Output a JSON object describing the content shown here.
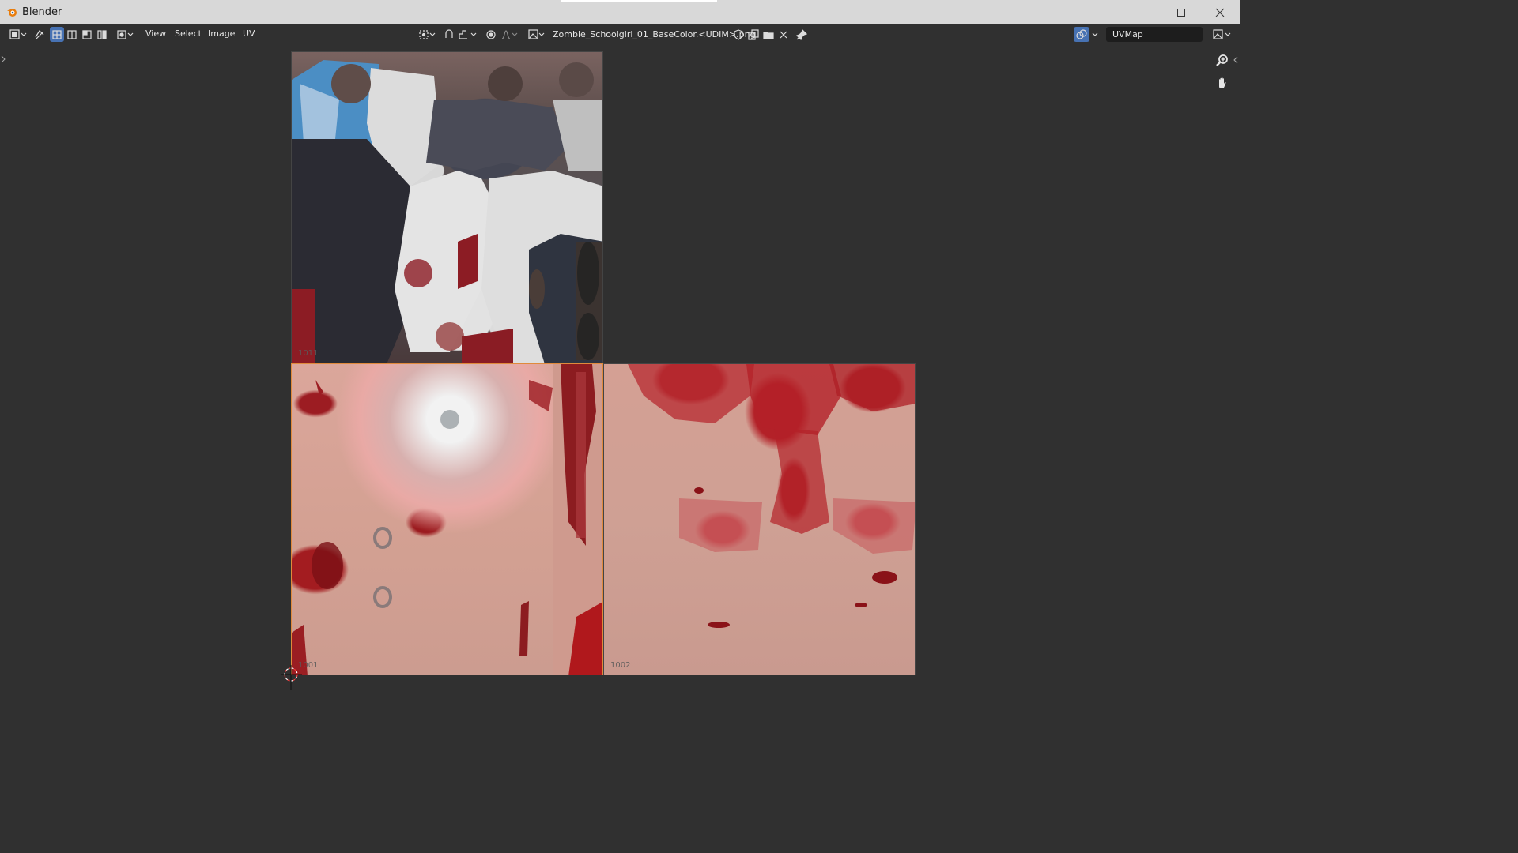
{
  "window": {
    "title": "Blender",
    "controls": [
      "minimize-icon",
      "maximize-icon",
      "close-icon"
    ]
  },
  "header": {
    "editor_type_icon": "image-editor-icon",
    "sync_selection_icon": "uv-sync-icon",
    "select_mode_icons": [
      "vertex-select-icon",
      "edge-select-icon",
      "face-select-icon",
      "island-select-icon"
    ],
    "sticky_selection_icon": "sticky-select-icon",
    "menus": [
      "View",
      "Select",
      "Image",
      "UV"
    ],
    "pivot_icon": "pivot-icon",
    "snap_icon": "snap-icon",
    "proportional_icon": "proportional-edit-icon",
    "image_browse_icon": "image-browse-icon",
    "image_name": "Zombie_Schoolgirl_01_BaseColor.<UDIM>.png",
    "image_actions": [
      "fake-user-icon",
      "new-image-icon",
      "open-image-icon",
      "unlink-icon"
    ],
    "pin_icon": "pin-icon",
    "overlay_icon": "overlay-icon",
    "uv_map": "UVMap",
    "display_icon": "display-channels-icon"
  },
  "viewport": {
    "tiles": [
      {
        "label": "1011"
      },
      {
        "label": "1001"
      },
      {
        "label": "1002"
      }
    ],
    "active_tile_color": "#e08a3c",
    "cursor_icon": "2d-cursor-icon",
    "gizmos": [
      "zoom-icon",
      "pan-hand-icon"
    ]
  },
  "colors": {
    "background": "#303030",
    "header": "#303030",
    "titlebar": "#d8d8d8",
    "accent": "#4772b3",
    "field": "#1d1d1d"
  }
}
